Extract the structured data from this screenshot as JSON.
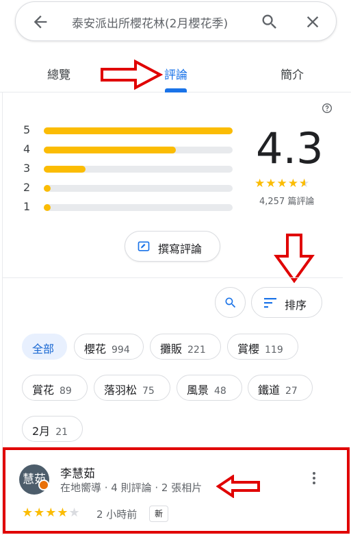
{
  "search": {
    "query": "泰安派出所櫻花林(2月櫻花季)"
  },
  "tabs": [
    {
      "label": "總覽"
    },
    {
      "label": "評論",
      "active": true
    },
    {
      "label": "簡介"
    }
  ],
  "rating_summary": {
    "score": "4.3",
    "stars": "★★★★★",
    "review_count": "4,257 篇評論",
    "histogram": [
      {
        "label": "5",
        "fraction": 1.0
      },
      {
        "label": "4",
        "fraction": 0.7
      },
      {
        "label": "3",
        "fraction": 0.22
      },
      {
        "label": "2",
        "fraction": 0.03
      },
      {
        "label": "1",
        "fraction": 0.03
      }
    ]
  },
  "actions": {
    "write_review": "撰寫評論",
    "sort": "排序"
  },
  "topic_chips": [
    {
      "label": "全部",
      "count": "",
      "active": true
    },
    {
      "label": "櫻花",
      "count": "994"
    },
    {
      "label": "攤販",
      "count": "221"
    },
    {
      "label": "賞櫻",
      "count": "119"
    },
    {
      "label": "賞花",
      "count": "89"
    },
    {
      "label": "落羽松",
      "count": "75"
    },
    {
      "label": "風景",
      "count": "48"
    },
    {
      "label": "鐵道",
      "count": "27"
    },
    {
      "label": "2月",
      "count": "21"
    }
  ],
  "review": {
    "avatar_text": "慧茹",
    "name": "李慧茹",
    "meta": "在地嚮導 · 4 則評論 · 2 張相片",
    "rating": 4,
    "stars_on": "★★★★",
    "stars_off": "★",
    "time": "2 小時前",
    "badge": "新"
  },
  "colors": {
    "accent": "#1a73e8",
    "star": "#fbbc04",
    "annotation": "#e00000"
  },
  "icons": [
    "back-arrow-icon",
    "search-icon",
    "close-icon",
    "help-icon",
    "write-review-icon",
    "sort-icon",
    "more-vert-icon"
  ]
}
